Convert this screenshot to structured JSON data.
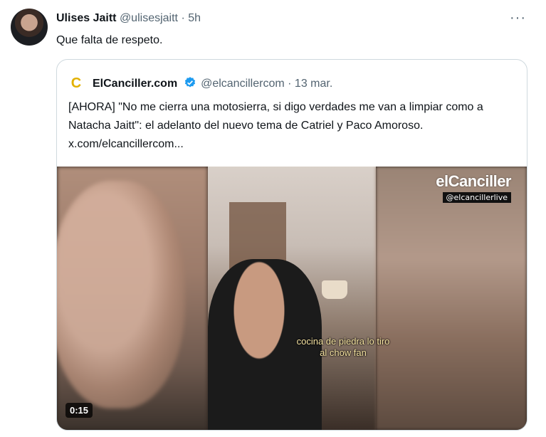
{
  "tweet": {
    "name": "Ulises Jaitt",
    "handle": "@ulisesjaitt",
    "separator": "·",
    "time": "5h",
    "more_icon": "more-horizontal-icon",
    "more_label": "···",
    "text": "Que falta de respeto."
  },
  "quote": {
    "logo_letter": "C",
    "name": "ElCanciller.com",
    "verified_icon": "verified-badge-icon",
    "verified_color": "#1d9bf0",
    "handle": "@elcancillercom",
    "separator": "·",
    "time": "13 mar.",
    "text": "[AHORA] \"No me cierra una motosierra, si digo verdades me van a limpiar como a Natacha Jaitt\": el adelanto del nuevo tema de Catriel y Paco Amoroso.  x.com/elcancillercom...",
    "media": {
      "watermark_title": "elCanciller",
      "watermark_handle": "@elcancillerlive",
      "subtitle": "cocina de piedra lo tiro al chow fan",
      "duration": "0:15"
    }
  }
}
